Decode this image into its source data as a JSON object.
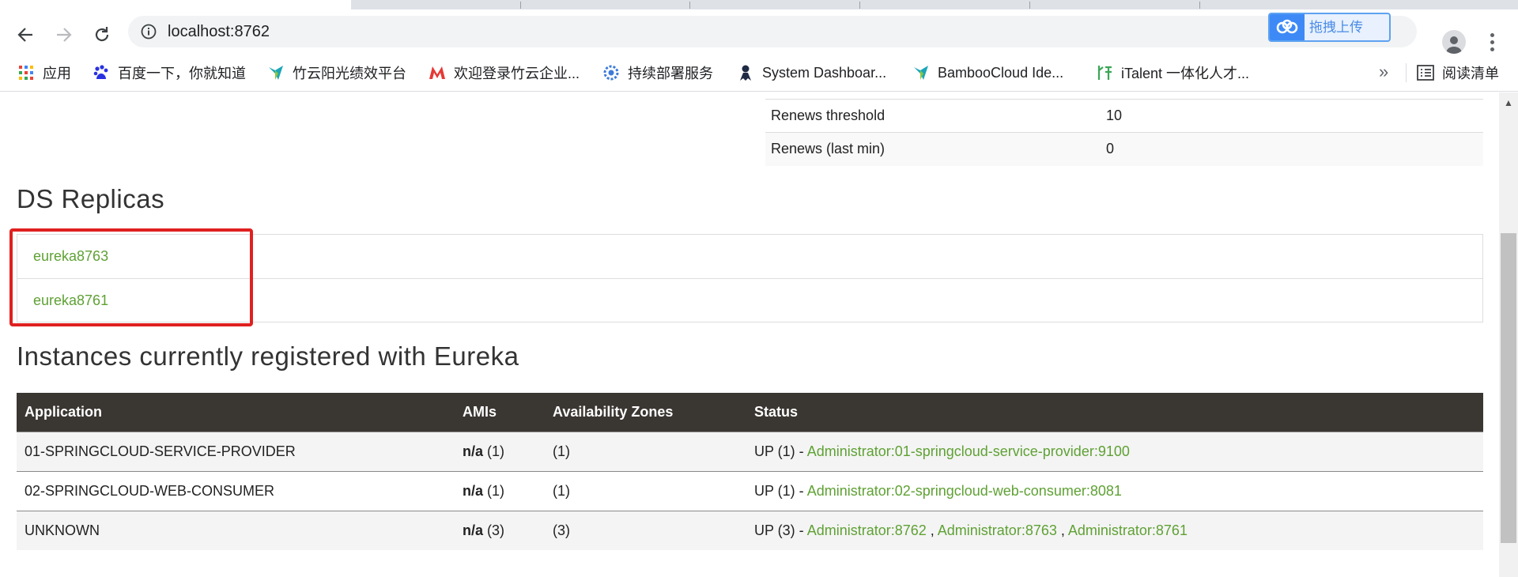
{
  "browser": {
    "url": "localhost:8762",
    "baidu_upload_label": "拖拽上传",
    "bookmarks": [
      {
        "label": "应用",
        "icon": "apps-grid-icon"
      },
      {
        "label": "百度一下，你就知道",
        "icon": "baidu-paw-icon"
      },
      {
        "label": "竹云阳光绩效平台",
        "icon": "bamboo-logo-icon"
      },
      {
        "label": "欢迎登录竹云企业...",
        "icon": "m-logo-icon"
      },
      {
        "label": "持续部署服务",
        "icon": "deploy-gear-icon"
      },
      {
        "label": "System Dashboar...",
        "icon": "jenkins-icon"
      },
      {
        "label": "BambooCloud Ide...",
        "icon": "bamboo-logo-icon"
      },
      {
        "label": "iTalent 一体化人才...",
        "icon": "italent-icon"
      }
    ],
    "bookmarks_more": "»",
    "reading_list": "阅读清单"
  },
  "stats": [
    {
      "label": "Renews threshold",
      "value": "10"
    },
    {
      "label": "Renews (last min)",
      "value": "0"
    }
  ],
  "ds_replicas": {
    "title": "DS Replicas",
    "items": [
      "eureka8763",
      "eureka8761"
    ]
  },
  "instances": {
    "title": "Instances currently registered with Eureka",
    "headers": [
      "Application",
      "AMIs",
      "Availability Zones",
      "Status"
    ],
    "rows": [
      {
        "app": "01-SPRINGCLOUD-SERVICE-PROVIDER",
        "ami_bold": "n/a",
        "ami_count": " (1)",
        "az": "(1)",
        "status_prefix": "UP (1) - ",
        "links": [
          "Administrator:01-springcloud-service-provider:9100"
        ]
      },
      {
        "app": "02-SPRINGCLOUD-WEB-CONSUMER",
        "ami_bold": "n/a",
        "ami_count": " (1)",
        "az": "(1)",
        "status_prefix": "UP (1) - ",
        "links": [
          "Administrator:02-springcloud-web-consumer:8081"
        ]
      },
      {
        "app": "UNKNOWN",
        "ami_bold": "n/a",
        "ami_count": " (3)",
        "az": "(3)",
        "status_prefix": "UP (3) - ",
        "links": [
          "Administrator:8762",
          "Administrator:8763",
          "Administrator:8761"
        ]
      }
    ]
  },
  "colors": {
    "link_green": "#5fa134",
    "table_header_bg": "#3a3632",
    "highlight_red": "#e02020"
  }
}
